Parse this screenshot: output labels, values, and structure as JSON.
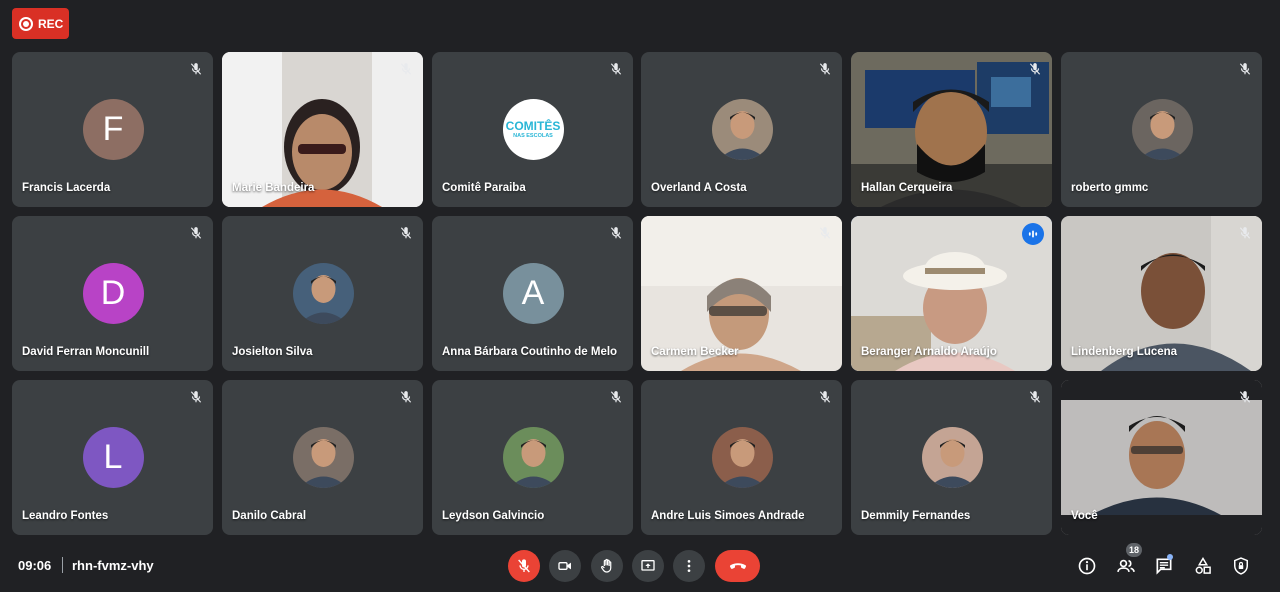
{
  "recording": {
    "label": "REC"
  },
  "participants": [
    {
      "name": "Francis Lacerda",
      "avatar_type": "initial",
      "initial": "F",
      "color": "#8d6e63",
      "muted": true
    },
    {
      "name": "Marie Bandeira",
      "avatar_type": "video",
      "muted": true
    },
    {
      "name": "Comitê Paraiba",
      "avatar_type": "logo",
      "logo_text": "COMITÊS",
      "logo_sub": "NAS ESCOLAS",
      "muted": true
    },
    {
      "name": "Overland A Costa",
      "avatar_type": "photo",
      "muted": true
    },
    {
      "name": "Hallan Cerqueira",
      "avatar_type": "video",
      "muted": true
    },
    {
      "name": "roberto gmmc",
      "avatar_type": "photo",
      "muted": true
    },
    {
      "name": "David Ferran Moncunill",
      "avatar_type": "initial",
      "initial": "D",
      "color": "#b843c6",
      "muted": true
    },
    {
      "name": "Josielton Silva",
      "avatar_type": "photo",
      "muted": true
    },
    {
      "name": "Anna Bárbara Coutinho de Melo",
      "avatar_type": "initial",
      "initial": "A",
      "color": "#78909c",
      "muted": true
    },
    {
      "name": "Carmem Becker",
      "avatar_type": "video",
      "muted": true
    },
    {
      "name": "Beranger Arnaldo Araújo",
      "avatar_type": "video",
      "muted": false,
      "speaking": true
    },
    {
      "name": "Lindenberg Lucena",
      "avatar_type": "video",
      "muted": true
    },
    {
      "name": "Leandro Fontes",
      "avatar_type": "initial",
      "initial": "L",
      "color": "#7e57c2",
      "muted": true
    },
    {
      "name": "Danilo Cabral",
      "avatar_type": "photo",
      "muted": true
    },
    {
      "name": "Leydson Galvincio",
      "avatar_type": "photo",
      "muted": true
    },
    {
      "name": "Andre Luis Simoes Andrade",
      "avatar_type": "photo",
      "muted": true
    },
    {
      "name": "Demmily Fernandes",
      "avatar_type": "photo",
      "muted": true
    },
    {
      "name": "Você",
      "avatar_type": "video",
      "muted": true
    }
  ],
  "footer": {
    "time": "09:06",
    "meeting_code": "rhn-fvmz-vhy",
    "participant_count": "18"
  },
  "colors": {
    "background": "#202124",
    "tile": "#3c4043",
    "danger": "#ea4335",
    "accent": "#1a73e8",
    "speaking_outline": "#8ab4f8"
  }
}
